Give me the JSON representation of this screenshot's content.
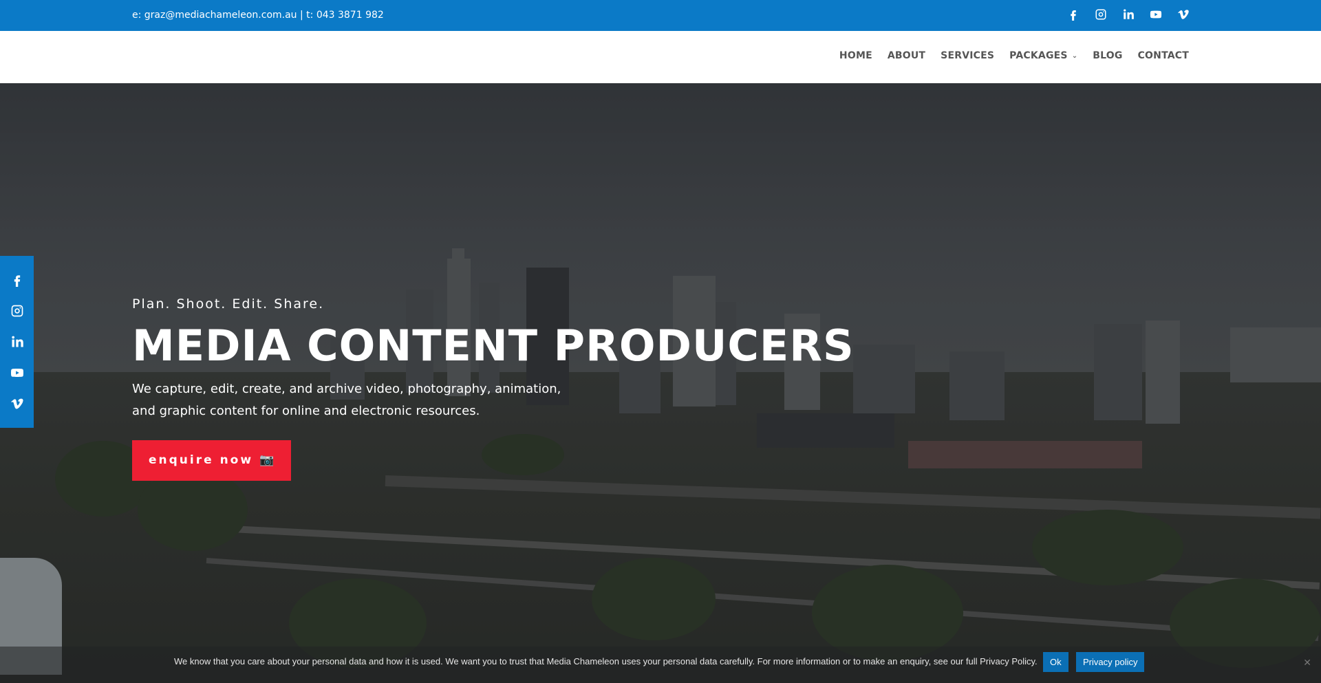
{
  "topbar": {
    "contact": "e: graz@mediachameleon.com.au | t: 043 3871 982",
    "social": [
      "facebook-icon",
      "instagram-icon",
      "linkedin-icon",
      "youtube-icon",
      "vimeo-icon"
    ]
  },
  "nav": {
    "items": [
      {
        "label": "HOME"
      },
      {
        "label": "ABOUT"
      },
      {
        "label": "SERVICES"
      },
      {
        "label": "PACKAGES"
      },
      {
        "label": "BLOG"
      },
      {
        "label": "CONTACT"
      }
    ]
  },
  "hero": {
    "tagline": "Plan. Shoot. Edit. Share.",
    "headline": "MEDIA CONTENT PRODUCERS",
    "subtext": "We capture, edit, create, and archive video, photography, animation, and graphic content for online and electronic resources.",
    "cta_label": "enquire now 📷"
  },
  "cookie": {
    "message": "We know that you care about your personal data and how it is used. We want you to trust that Media Chameleon uses your personal data carefully. For more information or to make an enquiry, see our full Privacy Policy.",
    "ok_label": "Ok",
    "privacy_label": "Privacy policy",
    "close_label": "✕"
  },
  "colors": {
    "brand_blue": "#0b7ac7",
    "cta_red": "#ee1f33"
  }
}
